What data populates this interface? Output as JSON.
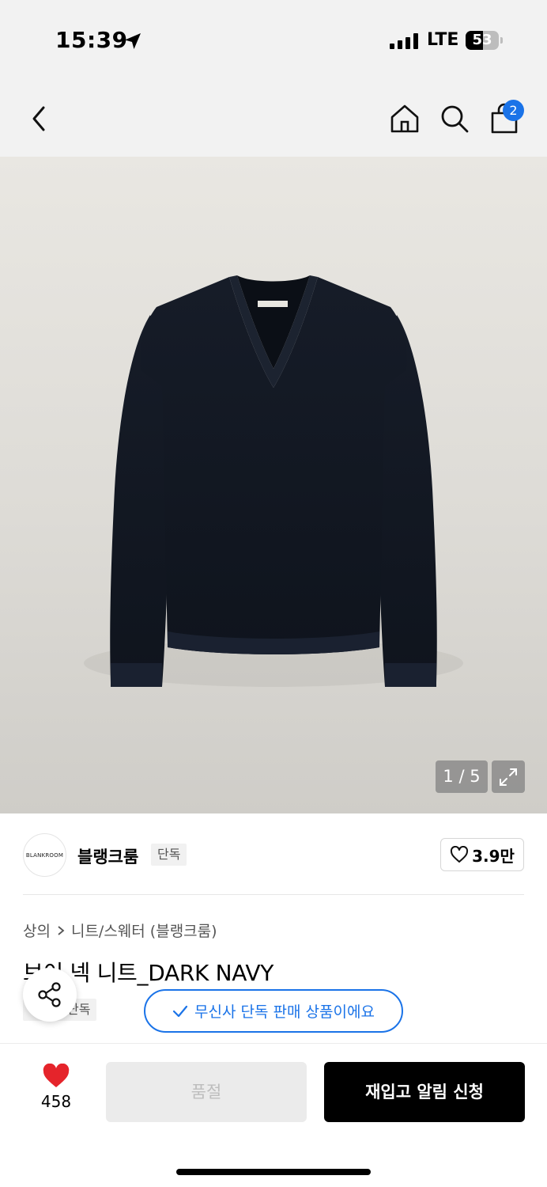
{
  "status_bar": {
    "time": "15:39",
    "network": "LTE",
    "battery_percent": "53",
    "battery_level": 0.53
  },
  "header": {
    "cart_count": "2",
    "icons": [
      "back-icon",
      "home-icon",
      "search-icon",
      "shopping-bag-icon"
    ]
  },
  "gallery": {
    "counter": "1 / 5",
    "label_on_garment": "BLANKROOM"
  },
  "brand": {
    "logo_text": "BLANKROOM",
    "name": "블랭크룸",
    "tag": "단독",
    "likes": "3.9만"
  },
  "breadcrumb": {
    "items": [
      "상의",
      "니트/스웨터 (블랭크룸)"
    ]
  },
  "product": {
    "title": "브이 넥 니트_DARK NAVY",
    "tag": "단독",
    "exclusive_notice": "무신사 단독 판매 상품이에요"
  },
  "bottom_bar": {
    "like_count": "458",
    "soldout_label": "품절",
    "restock_label": "재입고 알림 신청"
  },
  "colors": {
    "accent_blue": "#1a73e8",
    "heart_red": "#e5242b",
    "sweater_navy": "#141a26"
  }
}
